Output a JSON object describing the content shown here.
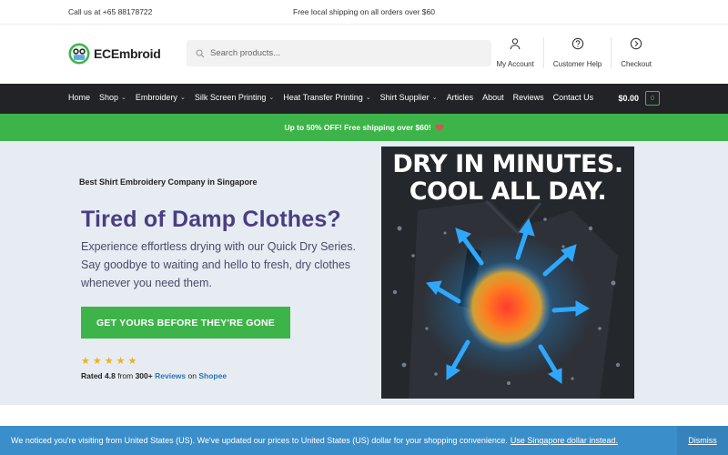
{
  "topbar": {
    "phone": "Call us at +65 88178722",
    "shipping": "Free local shipping on all orders over $60"
  },
  "header": {
    "logo_text": "ECEmbroid",
    "search_placeholder": "Search products...",
    "links": [
      {
        "label": "My Account",
        "icon": "user-icon"
      },
      {
        "label": "Customer Help",
        "icon": "help-icon"
      },
      {
        "label": "Checkout",
        "icon": "arrow-circle-icon"
      }
    ]
  },
  "nav": {
    "items": [
      {
        "label": "Home",
        "dropdown": false
      },
      {
        "label": "Shop",
        "dropdown": true
      },
      {
        "label": "Embroidery",
        "dropdown": true
      },
      {
        "label": "Silk Screen Printing",
        "dropdown": true
      },
      {
        "label": "Heat Transfer Printing",
        "dropdown": true
      },
      {
        "label": "Shirt Supplier",
        "dropdown": true
      },
      {
        "label": "Articles",
        "dropdown": false
      },
      {
        "label": "About",
        "dropdown": false
      },
      {
        "label": "Reviews",
        "dropdown": false
      },
      {
        "label": "Contact Us",
        "dropdown": false
      }
    ],
    "cart_total": "$0.00",
    "cart_count": "0"
  },
  "promo": {
    "text": "Up to 50% OFF! Free shipping over $60!",
    "icon": "heart-icon"
  },
  "hero": {
    "tagline": "Best Shirt Embroidery Company in Singapore",
    "headline": "Tired of Damp Clothes?",
    "description": "Experience effortless drying with our Quick Dry Series. Say goodbye to waiting and hello to fresh, dry clothes whenever you need them.",
    "cta": "GET YOURS BEFORE THEY'RE GONE",
    "stars": 5,
    "rating_prefix": "Rated",
    "rating_value": "4.8",
    "rating_from": "from",
    "review_count": "300+",
    "reviews_link": "Reviews",
    "rating_on": "on",
    "platform": "Shopee",
    "image_line1": "DRY IN MINUTES.",
    "image_line2": "COOL ALL DAY."
  },
  "notice": {
    "text": "We noticed you're visiting from United States (US). We've updated our prices to United States (US) dollar for your shopping convenience.",
    "link": "Use Singapore dollar instead.",
    "dismiss": "Dismiss"
  },
  "colors": {
    "brand_green": "#3db449",
    "nav_dark": "#222326",
    "headline_purple": "#4a3d82",
    "notice_blue": "#3a8fcb",
    "link_blue": "#2b72b8",
    "star_gold": "#f2b01e"
  }
}
